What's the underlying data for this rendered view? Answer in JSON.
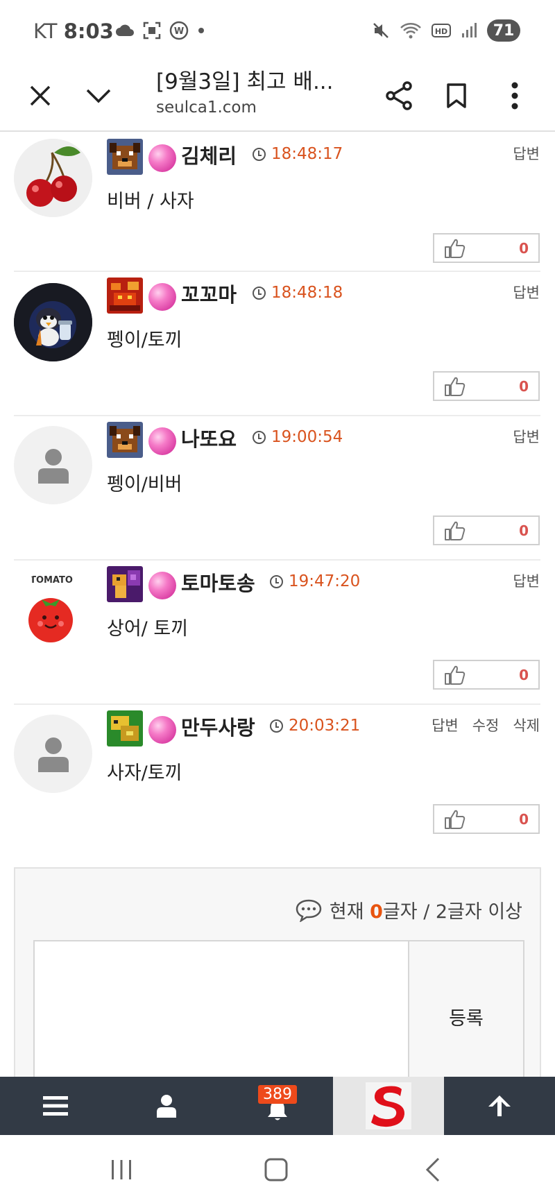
{
  "status_bar": {
    "carrier": "KT",
    "time": "8:03",
    "battery": "71",
    "icons": [
      "cloud-icon",
      "screenshot-icon",
      "w-badge-icon",
      "dot-icon",
      "mute-icon",
      "wifi-icon",
      "hd-icon",
      "signal-icon"
    ]
  },
  "browser": {
    "title": "[9월3일] 최고 배...",
    "url": "seulca1.com",
    "icons": [
      "close-icon",
      "chevron-down-icon",
      "share-icon",
      "bookmark-icon",
      "more-icon"
    ]
  },
  "comments": [
    {
      "nick": "김체리",
      "time": "18:48:17",
      "content": "비버 / 사자",
      "likes": "0",
      "actions": [
        "답변"
      ],
      "avatar": "cherry",
      "level_icon": "dog-bronze"
    },
    {
      "nick": "꼬꼬마",
      "time": "18:48:18",
      "content": "펭이/토끼",
      "likes": "0",
      "actions": [
        "답변"
      ],
      "avatar": "penguin",
      "level_icon": "red-dragon"
    },
    {
      "nick": "나또요",
      "time": "19:00:54",
      "content": "펭이/비버",
      "likes": "0",
      "actions": [
        "답변"
      ],
      "avatar": "default",
      "level_icon": "dog-bronze"
    },
    {
      "nick": "토마토송",
      "time": "19:47:20",
      "content": "상어/ 토끼",
      "likes": "0",
      "actions": [
        "답변"
      ],
      "avatar": "tomato",
      "avatar_text": "TOMATO",
      "level_icon": "purple-monster"
    },
    {
      "nick": "만두사랑",
      "time": "20:03:21",
      "content": "사자/토끼",
      "likes": "0",
      "actions": [
        "답변",
        "수정",
        "삭제"
      ],
      "avatar": "default",
      "level_icon": "green-gold"
    }
  ],
  "comment_form": {
    "counter_prefix": "현재 ",
    "counter_value": "0",
    "counter_suffix": "글자 / 2글자 이상",
    "submit_label": "등록",
    "textarea_value": ""
  },
  "site_nav": {
    "items": [
      "menu-icon",
      "user-icon",
      "bell-icon",
      "site-logo",
      "arrow-up-icon"
    ],
    "notification_count": "389",
    "bg_color": "#323a45"
  },
  "android_nav": [
    "recent-apps-icon",
    "home-icon",
    "back-icon"
  ],
  "colors": {
    "accent": "#e8540f",
    "time": "#d9531e",
    "like_count": "#d9534f"
  }
}
